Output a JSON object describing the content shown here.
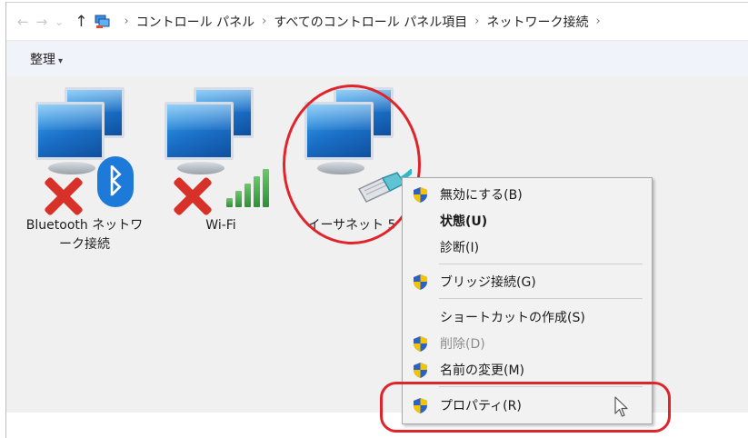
{
  "address_bar": {
    "back": "←",
    "forward": "→",
    "recent": "⌄",
    "up": "↑",
    "separator": "›",
    "breadcrumbs": [
      "コントロール パネル",
      "すべてのコントロール パネル項目",
      "ネットワーク接続"
    ]
  },
  "toolbar": {
    "organize_label": "整理",
    "organize_caret": "▾"
  },
  "network_items": [
    {
      "label_line1": "Bluetooth ネットワ",
      "label_line2": "ーク接続",
      "icon": "bluetooth-network-icon",
      "status": "disconnected"
    },
    {
      "label_line1": "Wi-Fi",
      "label_line2": "",
      "icon": "wifi-network-icon",
      "status": "disconnected"
    },
    {
      "label_line1": "イーサネット 5",
      "label_line2": "",
      "icon": "ethernet-network-icon",
      "status": "connected"
    }
  ],
  "context_menu": {
    "items": [
      {
        "label": "無効にする(B)",
        "shield": true,
        "bold": false,
        "disabled": false
      },
      {
        "label": "状態(U)",
        "shield": false,
        "bold": true,
        "disabled": false
      },
      {
        "label": "診断(I)",
        "shield": false,
        "bold": false,
        "disabled": false
      },
      {
        "label": "ブリッジ接続(G)",
        "shield": true,
        "bold": false,
        "disabled": false
      },
      {
        "label": "ショートカットの作成(S)",
        "shield": false,
        "bold": false,
        "disabled": false
      },
      {
        "label": "削除(D)",
        "shield": true,
        "bold": false,
        "disabled": true
      },
      {
        "label": "名前の変更(M)",
        "shield": true,
        "bold": false,
        "disabled": false
      },
      {
        "label": "プロパティ(R)",
        "shield": true,
        "bold": false,
        "disabled": false
      }
    ]
  },
  "colors": {
    "annotation_red": "#e0242b",
    "shield_blue": "#2a62c8",
    "shield_yellow": "#f5c400"
  }
}
